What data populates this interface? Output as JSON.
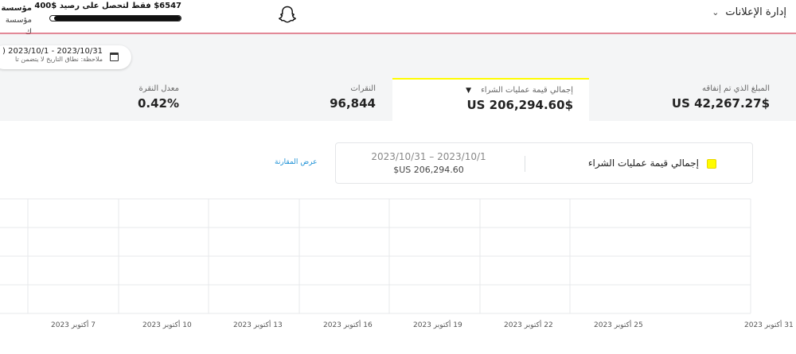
{
  "topbar": {
    "nav_menu_label": "إدارة الإعلانات",
    "promo_text": "$6547 فقط لتحصل على رصيد $400",
    "promo_progress": 0.97,
    "account_name": "مؤسسة",
    "account_sub": "مؤسسة ك"
  },
  "date_filter": {
    "range": "2023/10/31 - 2023/10/1 (",
    "note": "ملاحظة: نطاق التاريخ لا يتضمن تا"
  },
  "metrics": [
    {
      "label": "المبلغ الذي تم إنفاقه",
      "value": "$US 42,267.27"
    },
    {
      "label": "إجمالي قيمة عمليات الشراء",
      "value": "$US 206,294.60"
    },
    {
      "label": "النقرات",
      "value": "96,844"
    },
    {
      "label": "معدل النقرة",
      "value": "0.42%"
    }
  ],
  "legend": {
    "series_name": "إجمالي قيمة عمليات الشراء",
    "range": "2023/10/31 – 2023/10/1",
    "value": "$US 206,294.60"
  },
  "compare_link": "عرض المقارنة",
  "colors": {
    "accent_yellow": "#fffc00",
    "link_blue": "#1c90d5",
    "topbar_rule": "#d9475f"
  },
  "chart_data": {
    "type": "line",
    "categories": [
      "7 أكتوبر 2023",
      "10 أكتوبر 2023",
      "13 أكتوبر 2023",
      "16 أكتوبر 2023",
      "19 أكتوبر 2023",
      "22 أكتوبر 2023",
      "25 أكتوبر 2023",
      "31 أكتوبر 2023"
    ],
    "series": [],
    "grid": true
  }
}
